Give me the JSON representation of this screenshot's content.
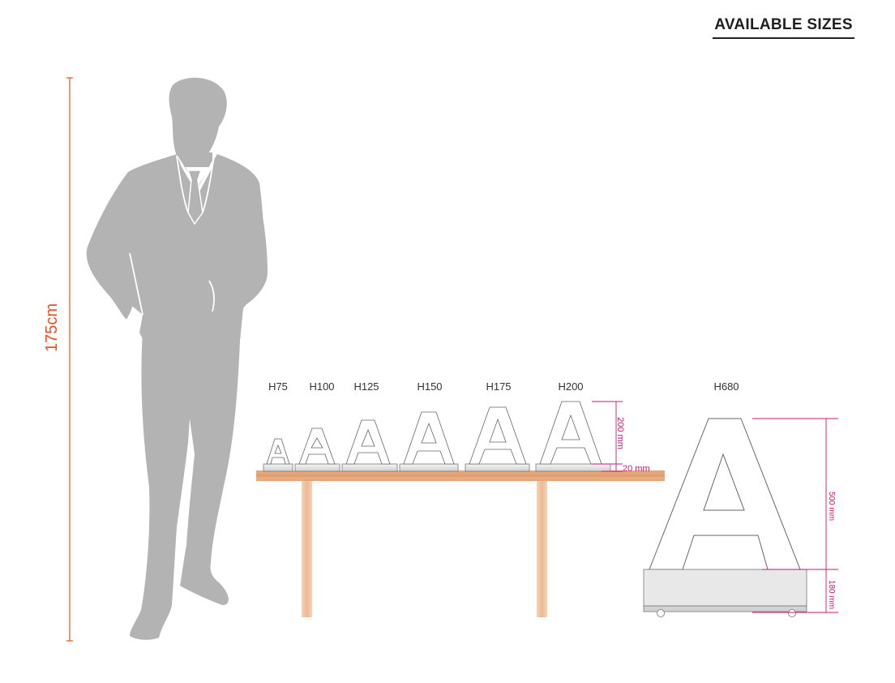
{
  "header": {
    "title": "AVAILABLE SIZES"
  },
  "person": {
    "height_label": "175cm",
    "icon": "person-silhouette-icon"
  },
  "sizes": [
    {
      "label": "H75"
    },
    {
      "label": "H100"
    },
    {
      "label": "H125"
    },
    {
      "label": "H150"
    },
    {
      "label": "H175"
    },
    {
      "label": "H200"
    }
  ],
  "h200_dimensions": {
    "letter": "200 mm",
    "base": "20 mm"
  },
  "large_letter": {
    "label": "H680",
    "letter_dim": "500 mm",
    "base_dim": "180 mm"
  },
  "colors": {
    "figure": "#b3b3b4",
    "table_top": "#e5a67a",
    "table_leg": "#f0c9a6",
    "dimension_pink": "#c8157f",
    "dimension_orange": "#e8501e",
    "letter_outline": "#666666"
  }
}
